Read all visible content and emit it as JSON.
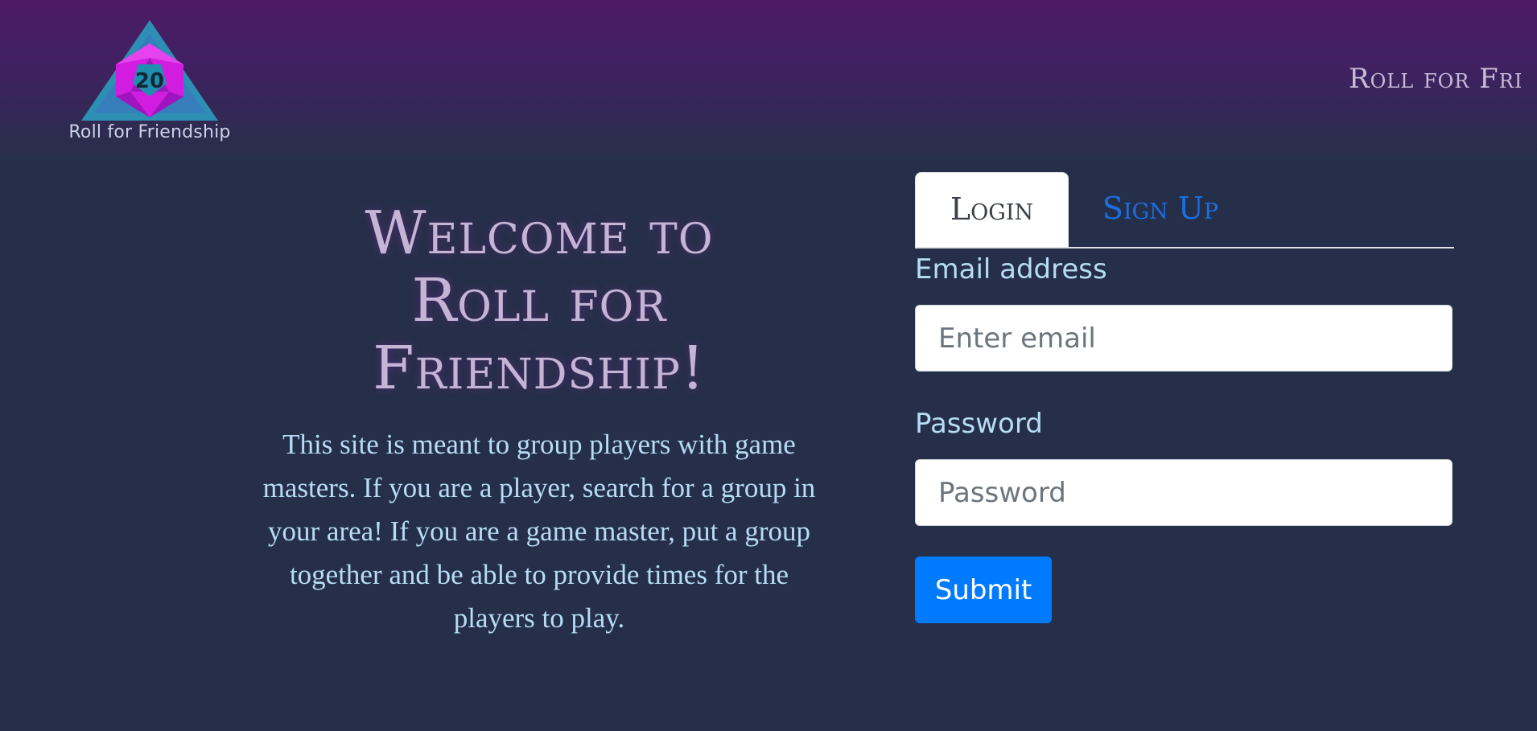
{
  "header": {
    "logo_text": "Roll for Friendship",
    "logo_die_number": "20",
    "nav_brand": "Roll for Fri"
  },
  "welcome": {
    "title_line1": "Welcome to",
    "title_line2": "Roll for",
    "title_line3": "Friendship!",
    "description": "This site is meant to group players with game masters. If you are a player, search for a group in your area! If you are a game master, put a group together and be able to provide times for the players to play."
  },
  "tabs": [
    {
      "label": "Login",
      "active": true
    },
    {
      "label": "Sign Up",
      "active": false
    }
  ],
  "form": {
    "email_label": "Email address",
    "email_placeholder": "Enter email",
    "email_value": "",
    "password_label": "Password",
    "password_placeholder": "Password",
    "password_value": "",
    "submit_label": "Submit"
  },
  "colors": {
    "background": "#262f49",
    "header_gradient_top": "#4f1a66",
    "accent_blue": "#007bff",
    "label_color": "#b7dcf6",
    "title_color": "#c4b4d6",
    "logo_triangle": "#2e8fb5",
    "logo_die": "#d21ce0"
  },
  "icons": {
    "logo": "d20-die-icon"
  }
}
